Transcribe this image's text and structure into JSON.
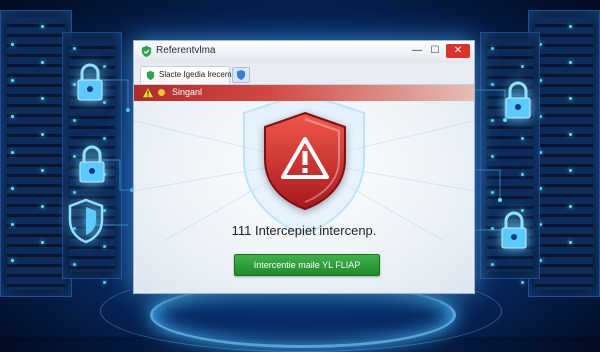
{
  "window": {
    "title": "Referentvlma",
    "controls": {
      "minimize": "—",
      "maximize": "☐",
      "close": "✕"
    }
  },
  "tab": {
    "label": "Slacte Igedia lrecemal"
  },
  "alert": {
    "text": "Singanl"
  },
  "dialog": {
    "message": "111 Intercepiet intercenp.",
    "action_label": "Intercentie maile YL FLIAP"
  },
  "colors": {
    "alert_red": "#c0342f",
    "shield_red": "#d4302a",
    "action_green": "#2e9e3a",
    "glow_blue": "#3fb4ff"
  },
  "icons": [
    "shield-check-icon",
    "shield-icon",
    "warning-icon",
    "lock-icon"
  ]
}
